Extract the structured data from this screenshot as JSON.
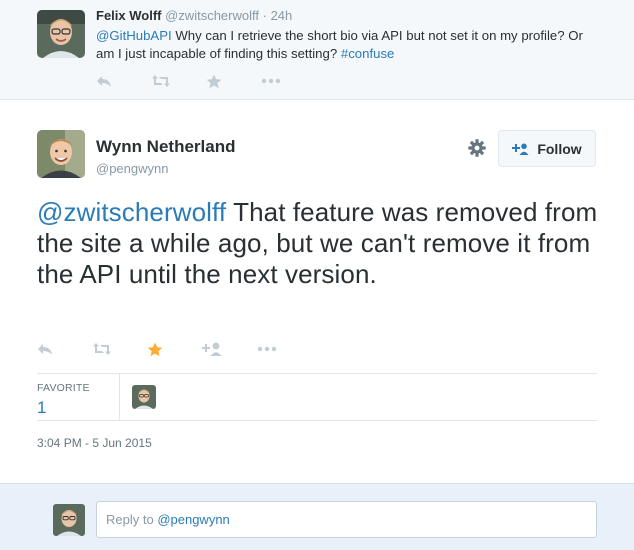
{
  "parent_tweet": {
    "name": "Felix Wolff",
    "handle": "@zwitscherwolff",
    "separator": "·",
    "time": "24h",
    "mention": "@GitHubAPI",
    "text_middle": " Why can I retrieve the short bio via API but not set it on my profile? Or am I just incapable of finding this setting? ",
    "hashtag": "#confuse"
  },
  "main_tweet": {
    "name": "Wynn Netherland",
    "handle": "@pengwynn",
    "follow_label": "Follow",
    "mention": "@zwitscherwolff",
    "text_rest": " That feature was removed from the site a while ago, but we can't remove it from the API until the next version.",
    "favorited": true,
    "stats": {
      "favorite_label": "FAVORITE",
      "favorite_count": "1"
    },
    "timestamp": "3:04 PM - 5 Jun 2015"
  },
  "reply": {
    "placeholder_prefix": "Reply to ",
    "placeholder_handle": "@pengwynn"
  },
  "colors": {
    "link": "#2b7bb9",
    "star_active": "#ffac33",
    "icon_muted": "#aab8c2",
    "reply_bg": "#e8f1f9"
  },
  "icons": [
    "reply-icon",
    "retweet-icon",
    "favorite-icon",
    "follow-icon",
    "more-icon",
    "gear-icon",
    "follow-user-icon"
  ]
}
